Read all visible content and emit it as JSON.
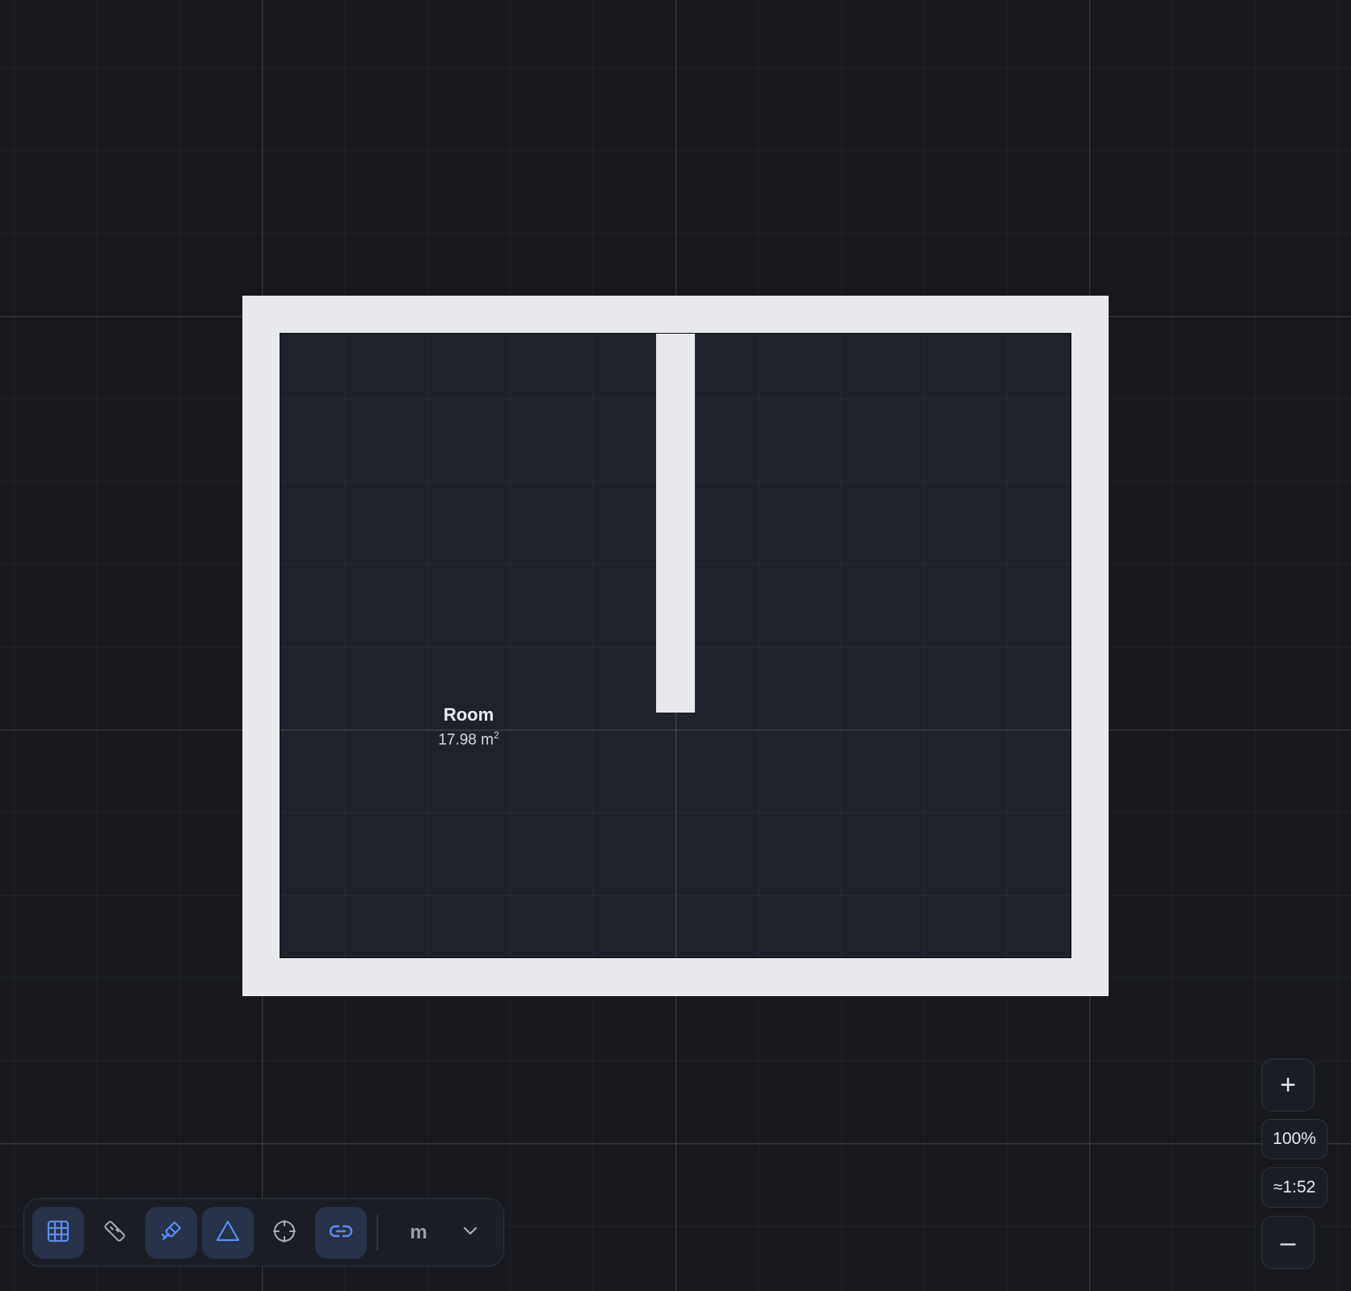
{
  "room": {
    "name": "Room",
    "area_value": "17.98 m",
    "area_unit_sup": "2"
  },
  "toolbar": {
    "tools": [
      {
        "icon": "grid-icon",
        "active": true
      },
      {
        "icon": "ruler-icon",
        "active": false
      },
      {
        "icon": "magnet-icon",
        "active": true
      },
      {
        "icon": "triangle-icon",
        "active": true
      },
      {
        "icon": "crosshair-icon",
        "active": false
      },
      {
        "icon": "link-icon",
        "active": true
      }
    ],
    "unit": "m",
    "unit_dropdown_icon": "chevron-down-icon"
  },
  "zoom": {
    "in_label": "+",
    "level": "100%",
    "scale": "≈1:52",
    "out_label": "–"
  },
  "colors": {
    "background": "#16181d",
    "wall": "#e8e9ec",
    "floor": "#1e222a",
    "accent": "#5b8df5",
    "active_tool_bg": "#283248"
  }
}
